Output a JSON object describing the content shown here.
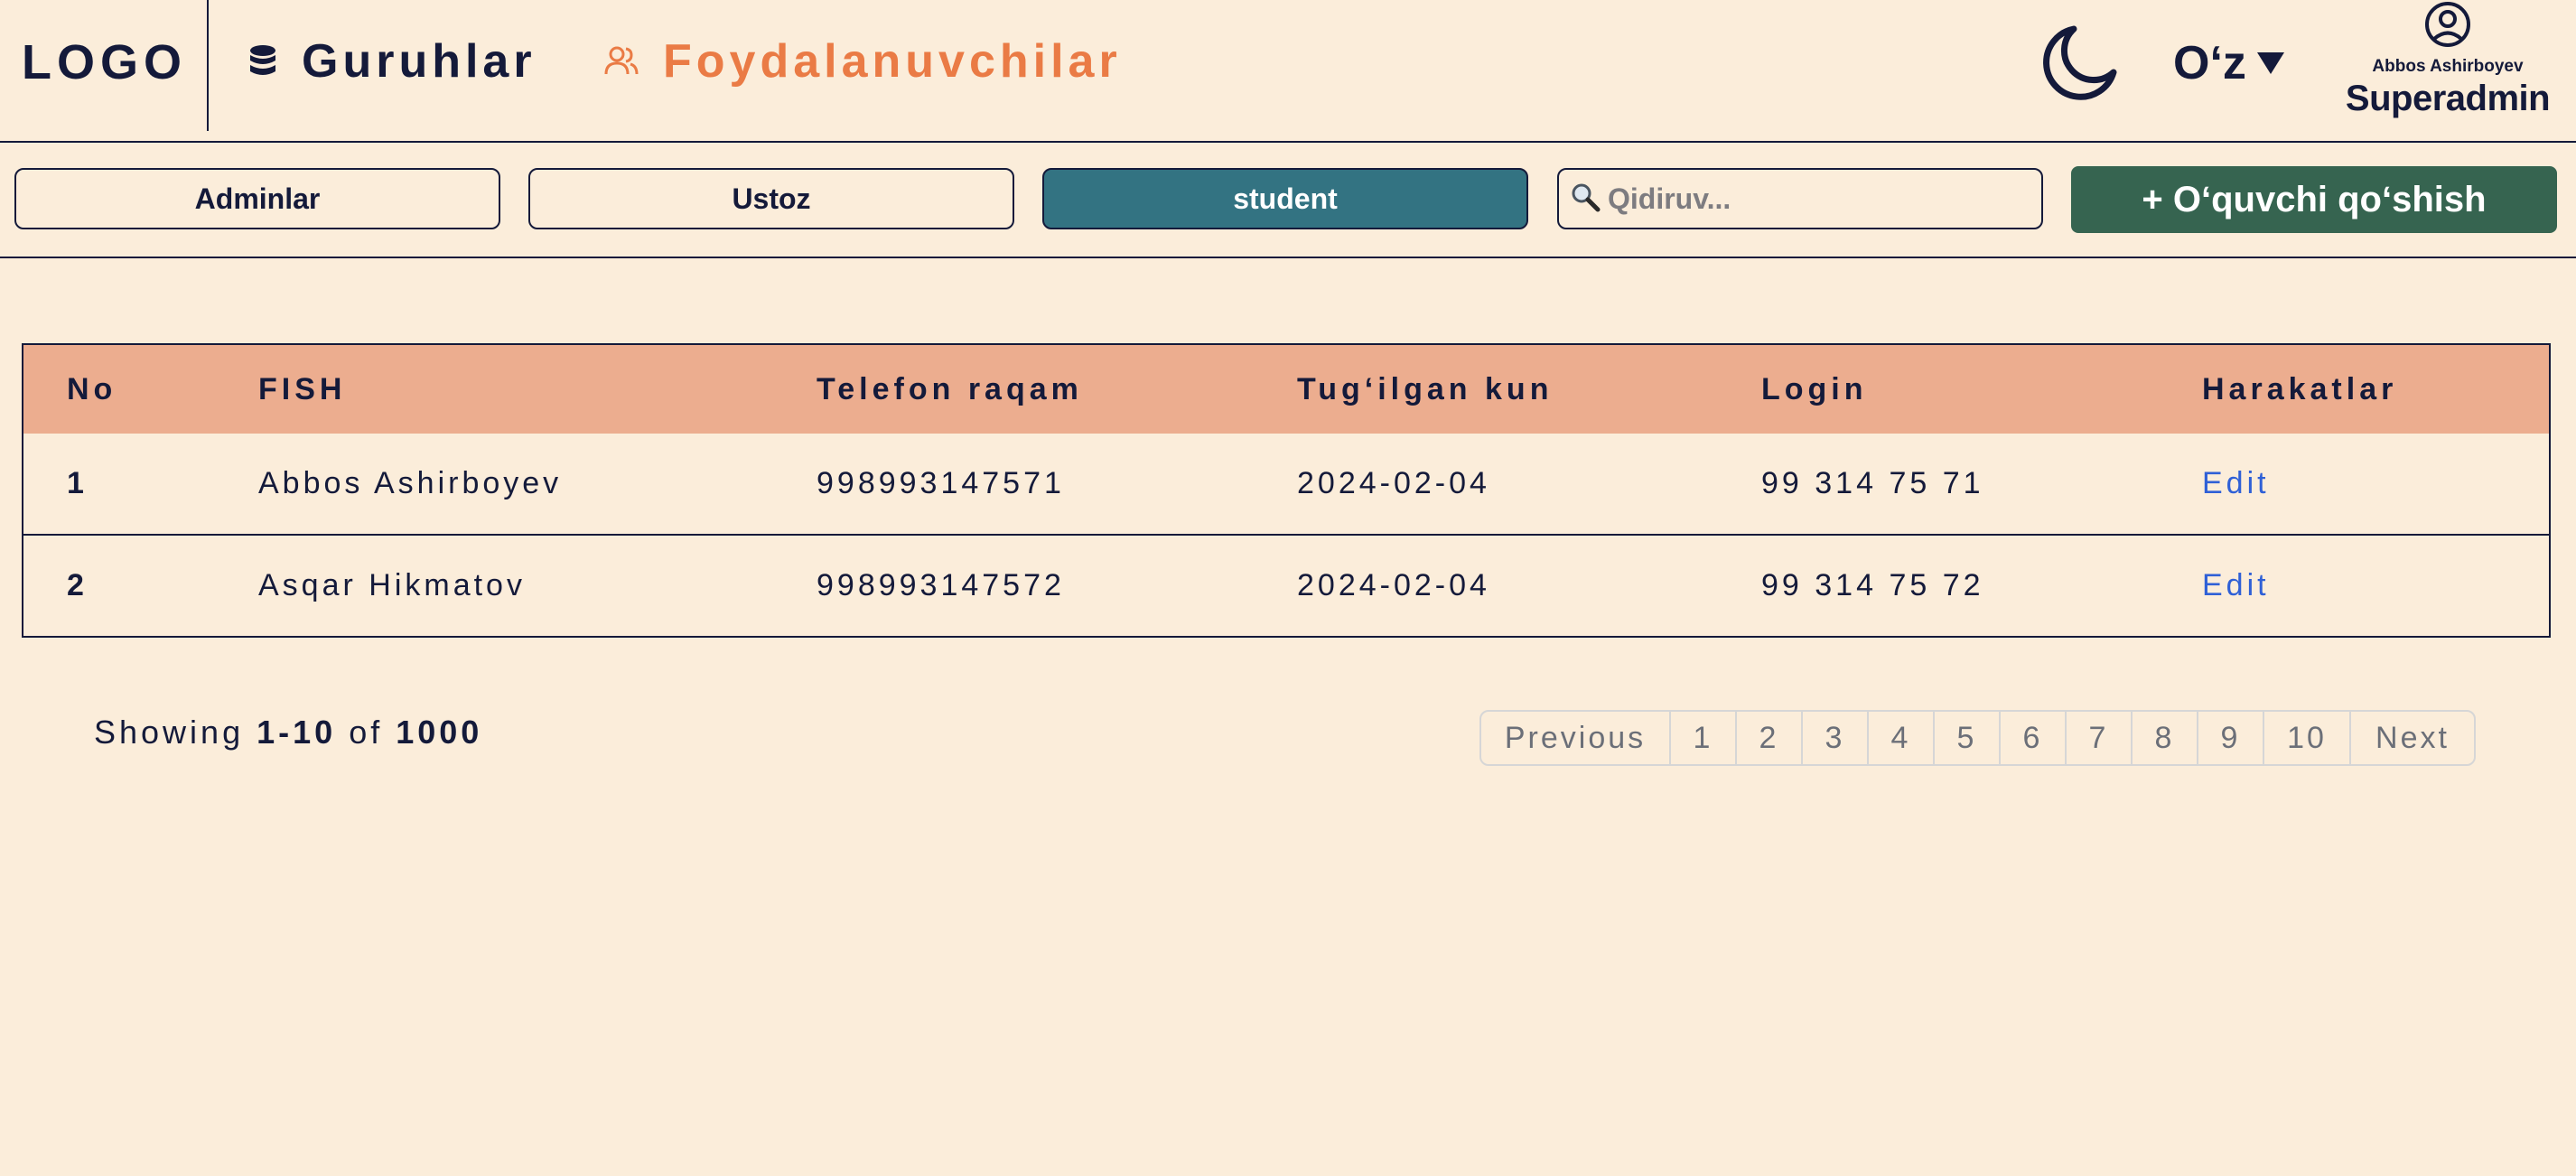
{
  "navbar": {
    "logo": "LOGO",
    "nav_groups": "Guruhlar",
    "nav_users": "Foydalanuvchilar",
    "language": "O‘z",
    "user_name": "Abbos Ashirboyev",
    "user_role": "Superadmin"
  },
  "filters": {
    "tabs": [
      "Adminlar",
      "Ustoz",
      "student"
    ],
    "active_tab": "student",
    "search_placeholder": "Qidiruv...",
    "search_value": "",
    "add_button": "+ O‘quvchi qo‘shish"
  },
  "table": {
    "headers": [
      "No",
      "FISH",
      "Telefon raqam",
      "Tug‘ilgan kun",
      "Login",
      "Harakatlar"
    ],
    "rows": [
      {
        "no": "1",
        "fish": "Abbos Ashirboyev",
        "phone": "998993147571",
        "birthday": "2024-02-04",
        "login": "99 314 75 71",
        "action": "Edit"
      },
      {
        "no": "2",
        "fish": "Asqar Hikmatov",
        "phone": "998993147572",
        "birthday": "2024-02-04",
        "login": "99 314 75 72",
        "action": "Edit"
      }
    ]
  },
  "pagination": {
    "showing_prefix": "Showing",
    "range": "1-10",
    "of_label": "of",
    "total": "1000",
    "previous": "Previous",
    "pages": [
      "1",
      "2",
      "3",
      "4",
      "5",
      "6",
      "7",
      "8",
      "9",
      "10"
    ],
    "next": "Next"
  },
  "colors": {
    "background": "#fbedda",
    "text": "#141a3a",
    "accent_orange": "#ea7b45",
    "table_header": "#ecad8f",
    "active_tab": "#337382",
    "add_button": "#366450",
    "link_blue": "#2f60d6"
  },
  "icons": {
    "groups": "database-icon",
    "users": "users-icon",
    "theme": "moon-icon",
    "language": "caret-down-icon",
    "profile": "user-circle-icon",
    "search": "magnifier-icon"
  }
}
